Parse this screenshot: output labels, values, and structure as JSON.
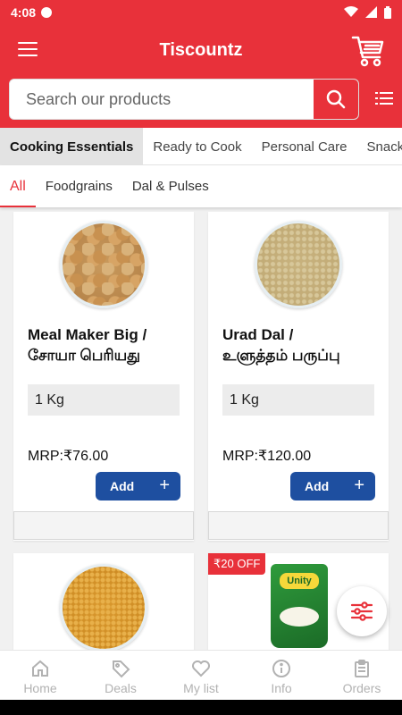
{
  "status_bar": {
    "time": "4:08"
  },
  "app": {
    "title": "Tiscountz"
  },
  "search": {
    "placeholder": "Search our products"
  },
  "category_tabs": [
    {
      "label": "Cooking Essentials",
      "active": true
    },
    {
      "label": "Ready to Cook",
      "active": false
    },
    {
      "label": "Personal Care",
      "active": false
    },
    {
      "label": "Snacks",
      "active": false
    }
  ],
  "sub_tabs": [
    {
      "label": "All",
      "active": true
    },
    {
      "label": "Foodgrains",
      "active": false
    },
    {
      "label": "Dal & Pulses",
      "active": false
    }
  ],
  "products": [
    {
      "name_line1": "Meal Maker Big /",
      "name_line2": "சோயா பெரியது",
      "quantity": "1 Kg",
      "mrp": "MRP:₹76.00",
      "add_label": "Add",
      "image_icon": "soya-chunks-bowl"
    },
    {
      "name_line1": "Urad Dal /",
      "name_line2": "உளுத்தம் பருப்பு",
      "quantity": "1 Kg",
      "mrp": "MRP:₹120.00",
      "add_label": "Add",
      "image_icon": "urad-dal-bowl"
    },
    {
      "image_icon": "dal-bowl"
    },
    {
      "badge": "₹20 OFF",
      "image_icon": "rice-bag",
      "brand_label": "Unity"
    }
  ],
  "bottom_nav": [
    {
      "label": "Home",
      "icon": "home-icon"
    },
    {
      "label": "Deals",
      "icon": "tag-icon"
    },
    {
      "label": "My list",
      "icon": "heart-icon"
    },
    {
      "label": "Info",
      "icon": "info-icon"
    },
    {
      "label": "Orders",
      "icon": "clipboard-icon"
    }
  ],
  "colors": {
    "primary": "#e8313a",
    "add_button": "#1e4fa0",
    "nav_inactive": "#b2b2b2"
  }
}
